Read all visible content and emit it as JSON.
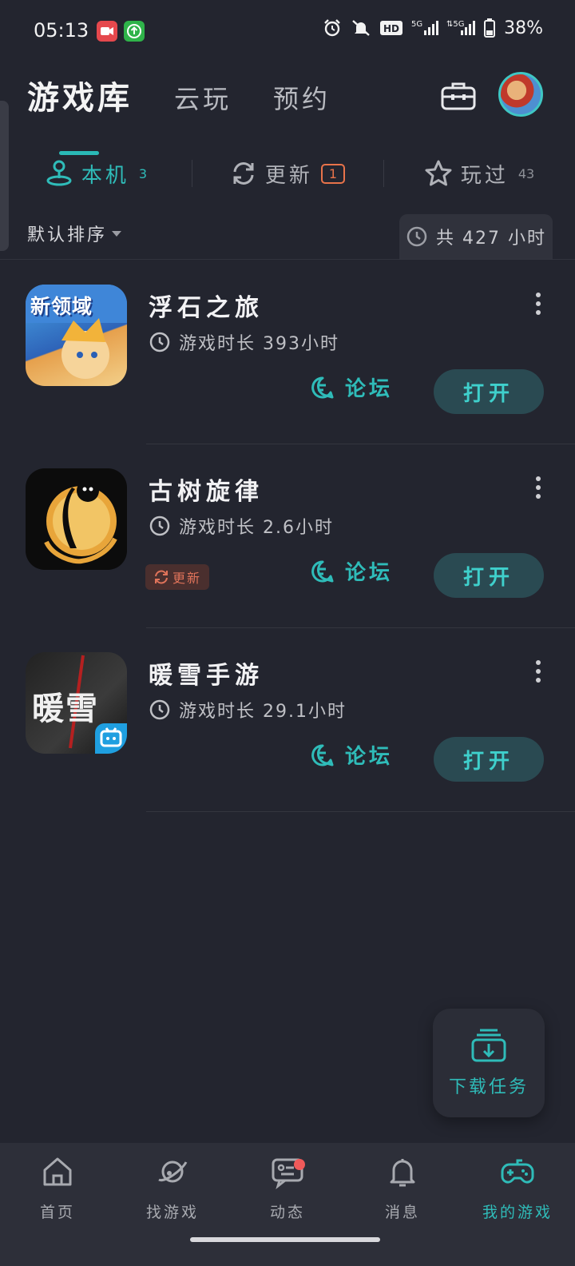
{
  "status_bar": {
    "time": "05:13",
    "battery": "38%",
    "icons": [
      "screen-record-icon",
      "upload-icon",
      "alarm-icon",
      "mute-icon",
      "hd-icon",
      "signal-5g-icon",
      "signal-5g-icon",
      "battery-icon"
    ]
  },
  "header": {
    "tabs": [
      {
        "label": "游戏库",
        "active": true
      },
      {
        "label": "云玩",
        "active": false
      },
      {
        "label": "预约",
        "active": false
      }
    ],
    "accent": "#2ab9b6"
  },
  "subtabs": [
    {
      "label": "本机",
      "count": "3",
      "icon": "joystick-icon",
      "active": true
    },
    {
      "label": "更新",
      "badge": "1",
      "icon": "refresh-icon",
      "active": false
    },
    {
      "label": "玩过",
      "count": "43",
      "icon": "star-icon",
      "active": false
    }
  ],
  "sort": {
    "label": "默认排序"
  },
  "total": {
    "text": "共 427 小时"
  },
  "games": [
    {
      "name": "浮石之旅",
      "playtime": "游戏时长 393小时",
      "forum": "论坛",
      "open": "打开",
      "icon_text": "新领域",
      "update_tag": ""
    },
    {
      "name": "古树旋律",
      "playtime": "游戏时长 2.6小时",
      "forum": "论坛",
      "open": "打开",
      "icon_text": "",
      "update_tag": "更新"
    },
    {
      "name": "暖雪手游",
      "playtime": "游戏时长 29.1小时",
      "forum": "论坛",
      "open": "打开",
      "icon_text": "暖雪",
      "update_tag": ""
    }
  ],
  "download_fab": {
    "label": "下载任务"
  },
  "bottom_nav": [
    {
      "label": "首页",
      "icon": "home-icon",
      "active": false
    },
    {
      "label": "找游戏",
      "icon": "planet-icon",
      "active": false
    },
    {
      "label": "动态",
      "icon": "chat-icon",
      "active": false,
      "dot": true
    },
    {
      "label": "消息",
      "icon": "bell-icon",
      "active": false
    },
    {
      "label": "我的游戏",
      "icon": "gamepad-icon",
      "active": true
    }
  ]
}
